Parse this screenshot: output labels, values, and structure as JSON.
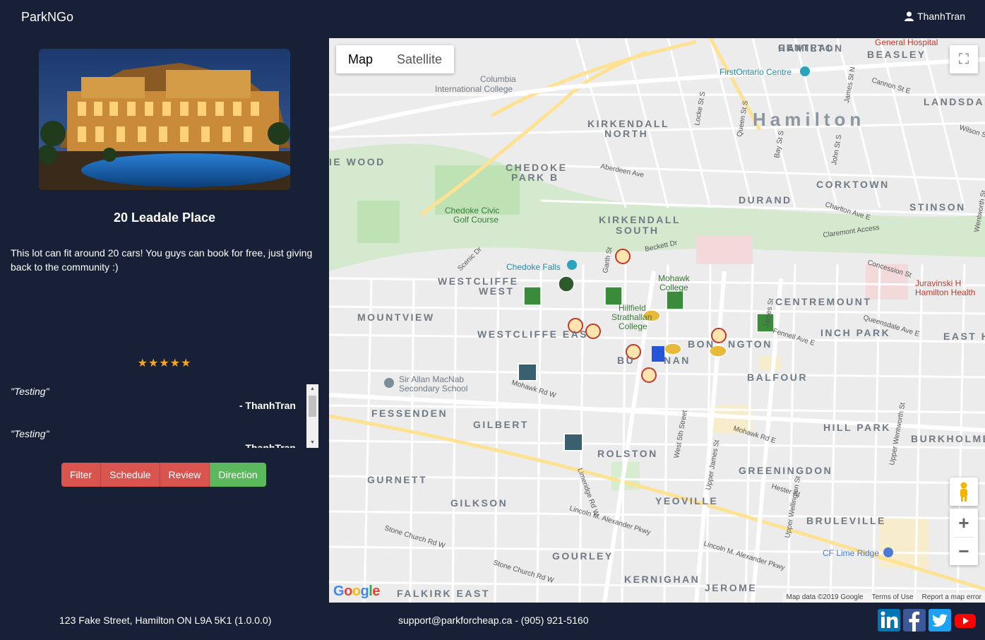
{
  "navbar": {
    "brand": "ParkNGo",
    "user": "ThanhTran"
  },
  "lot": {
    "title": "20 Leadale Place",
    "description": "This lot can fit around 20 cars! You guys can book for free, just giving back to the community :)",
    "stars": "★★★★★",
    "rating": 5
  },
  "reviews": [
    {
      "text": "\"Testing\"",
      "author": "- ThanhTran"
    },
    {
      "text": "\"Testing\"",
      "author": "- ThanhTran"
    }
  ],
  "buttons": {
    "filter": "Filter",
    "schedule": "Schedule",
    "review": "Review",
    "direction": "Direction"
  },
  "map": {
    "type_map": "Map",
    "type_satellite": "Satellite",
    "logo": "Google",
    "data_label": "Map data ©2019 Google",
    "terms": "Terms of Use",
    "report": "Report a map error",
    "labels": [
      "CENTRAL HAMILTON",
      "BEASLEY",
      "General Hospital",
      "FirstOntario Centre",
      "Columbia International College",
      "Hamilton",
      "LANDSDALE",
      "KIRKENDALL NORTH",
      "CHEDOKE PARK B",
      "IE WOOD",
      "CORKTOWN",
      "DURAND",
      "STINSON",
      "Chedoke Civic Golf Course",
      "KIRKENDALL SOUTH",
      "Chedoke Falls",
      "WESTCLIFFE WEST",
      "Mohawk College",
      "Hillfield Strathallan College",
      "CENTREMOUNT",
      "Juravinski Hamilton Health",
      "MOUNTVIEW",
      "WESTCLIFFE EAS",
      "INCH PARK",
      "EAST H",
      "BONNINGTON",
      "BUCHANAN",
      "BALFOUR",
      "Sir Allan MacNab Secondary School",
      "FESSENDEN",
      "GILBERT",
      "HILL PARK",
      "BURKHOLME",
      "ROLSTON",
      "GREENINGDON",
      "GURNETT",
      "GILKSON",
      "YEOVILLE",
      "BRULEVILLE",
      "CF Lime Ridge",
      "GOURLEY",
      "KERNIGHAN",
      "JEROME",
      "FALKIRK EAST",
      "Lincoln M. Alexander Pkwy",
      "Stone Church Rd W",
      "Mohawk Rd W",
      "Mohawk Rd E",
      "Aberdeen Ave",
      "Charlton Ave E",
      "Claremont Access",
      "Concession St",
      "Queensdale Ave E",
      "Upper James St",
      "Upper Wentworth St",
      "Upper Wellington St",
      "West 5th Street",
      "Garth St",
      "Beckett Dr",
      "Scenic Dr",
      "Cannon St E",
      "Wilson St",
      "Hester St",
      "Locke St S",
      "Queen St S",
      "Bay St S",
      "John St S",
      "James St N",
      "Limeridge Rd W",
      "Upper Ottawa St",
      "Fennell Ave E",
      "Wentworth St"
    ]
  },
  "footer": {
    "address": "123 Fake Street, Hamilton ON L9A 5K1 (1.0.0.0)",
    "contact": "support@parkforcheap.ca - (905) 921-5160"
  },
  "social": [
    "linkedin-icon",
    "facebook-icon",
    "twitter-icon",
    "youtube-icon"
  ],
  "colors": {
    "background": "#172036",
    "red_button": "#d9534f",
    "green_button": "#5cb85c",
    "star": "#f5a623"
  }
}
